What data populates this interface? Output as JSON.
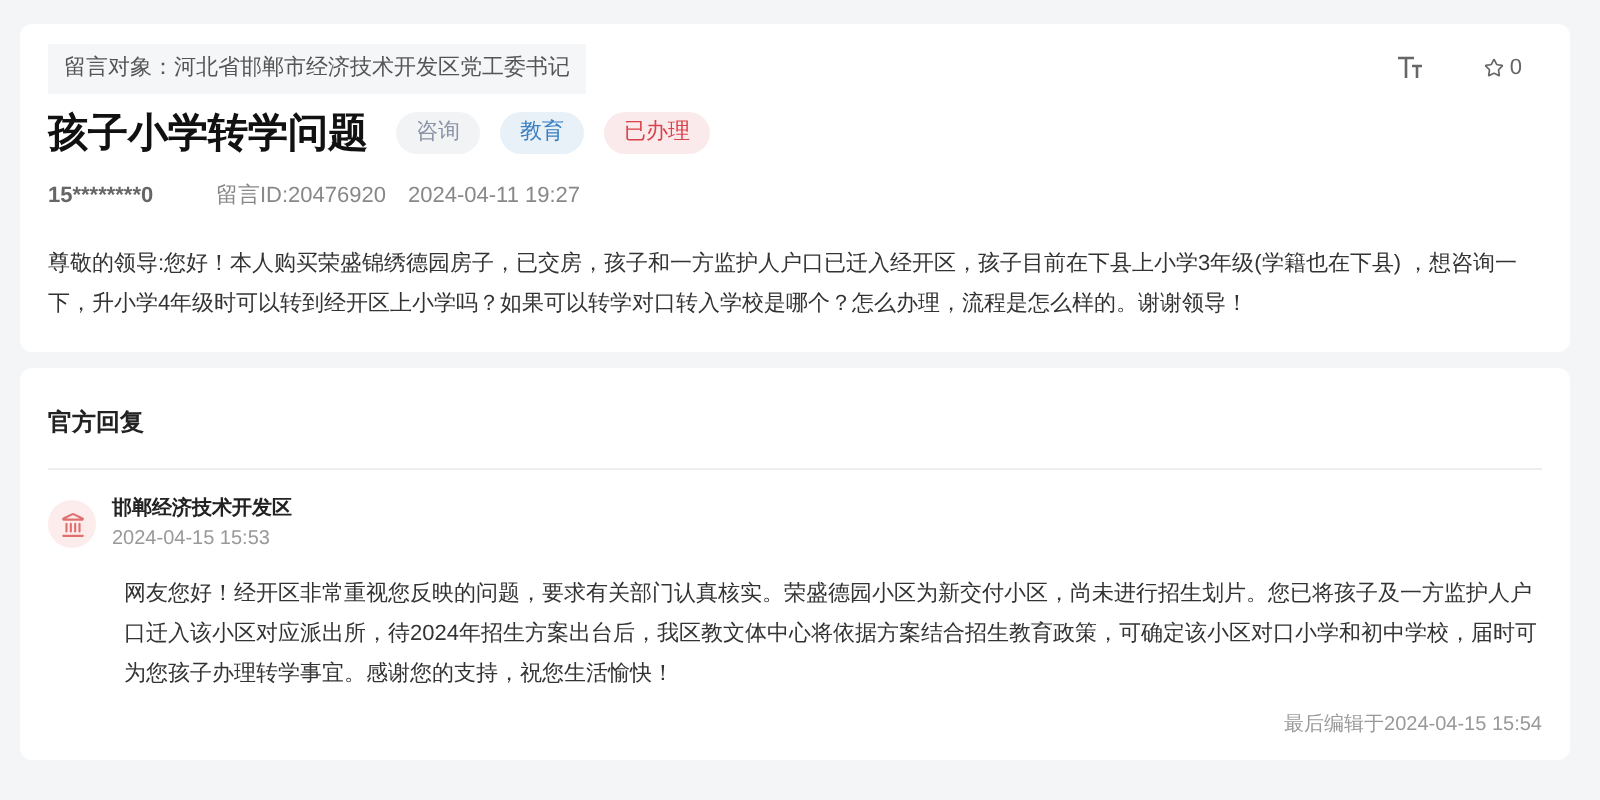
{
  "message": {
    "target": "留言对象：河北省邯郸市经济技术开发区党工委书记",
    "title": "孩子小学转学问题",
    "tags": [
      {
        "label": "咨询",
        "color": "#8a94a6"
      },
      {
        "label": "教育",
        "color": "#3a7fc0"
      },
      {
        "label": "已办理",
        "color": "#d9434b"
      }
    ],
    "author": "15********0",
    "id": "留言ID:20476920",
    "time": "2024-04-11 19:27",
    "favorites": "0",
    "body": "尊敬的领导:您好！本人购买荣盛锦绣德园房子，已交房，孩子和一方监护人户口已迁入经开区，孩子目前在下县上小学3年级(学籍也在下县) ，想咨询一下，升小学4年级时可以转到经开区上小学吗？如果可以转学对口转入学校是哪个？怎么办理，流程是怎么样的。谢谢领导！"
  },
  "reply": {
    "heading": "官方回复",
    "org": "邯郸经济技术开发区",
    "time": "2024-04-15 15:53",
    "body": "网友您好！经开区非常重视您反映的问题，要求有关部门认真核实。荣盛德园小区为新交付小区，尚未进行招生划片。您已将孩子及一方监护人户口迁入该小区对应派出所，待2024年招生方案出台后，我区教文体中心将依据方案结合招生教育政策，可确定该小区对口小学和初中学校，届时可为您孩子办理转学事宜。感谢您的支持，祝您生活愉快！",
    "edited": "最后编辑于2024-04-15 15:54"
  }
}
